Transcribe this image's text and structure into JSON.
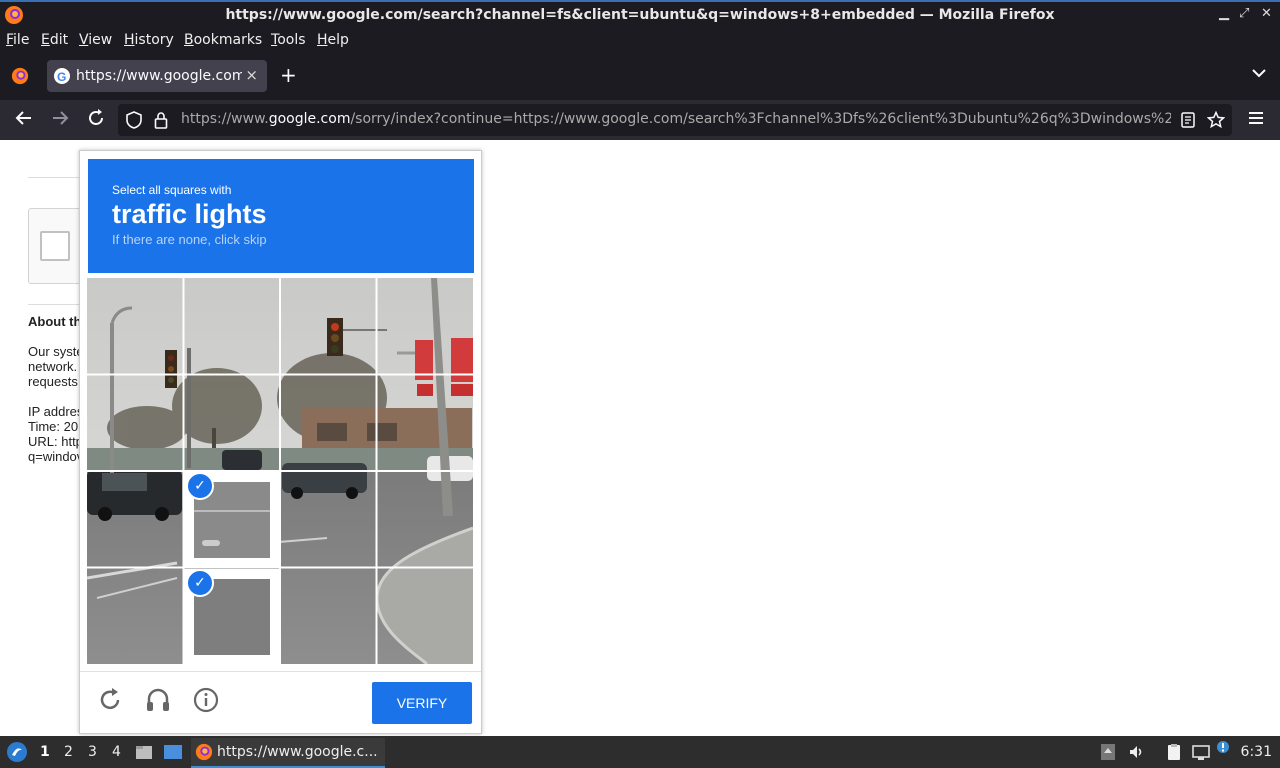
{
  "window": {
    "title": "https://www.google.com/search?channel=fs&client=ubuntu&q=windows+8+embedded — Mozilla Firefox"
  },
  "menu": [
    "File",
    "Edit",
    "View",
    "History",
    "Bookmarks",
    "Tools",
    "Help"
  ],
  "tab": {
    "label": "https://www.google.com/",
    "close": "×"
  },
  "newtab": "+",
  "url": {
    "prefix": "https://www.",
    "domain": "google.com",
    "rest": "/sorry/index?continue=https://www.google.com/search%3Fchannel%3Dfs%26client%3Dubuntu%26q%3Dwindows%2"
  },
  "page": {
    "about": "About th",
    "body_lines": [
      "Our syste",
      "network.",
      "requests"
    ],
    "meta_lines": [
      "IP addres",
      "Time: 20",
      "URL: http",
      "q=windov"
    ]
  },
  "captcha": {
    "line1": "Select all squares with",
    "line2": "traffic lights",
    "line3": "If there are none, click skip",
    "verify": "VERIFY",
    "selected_tiles": [
      9,
      13
    ]
  },
  "taskbar": {
    "workspaces": [
      "1",
      "2",
      "3",
      "4"
    ],
    "task_label": "https://www.google.c...",
    "clock": "6:31"
  }
}
